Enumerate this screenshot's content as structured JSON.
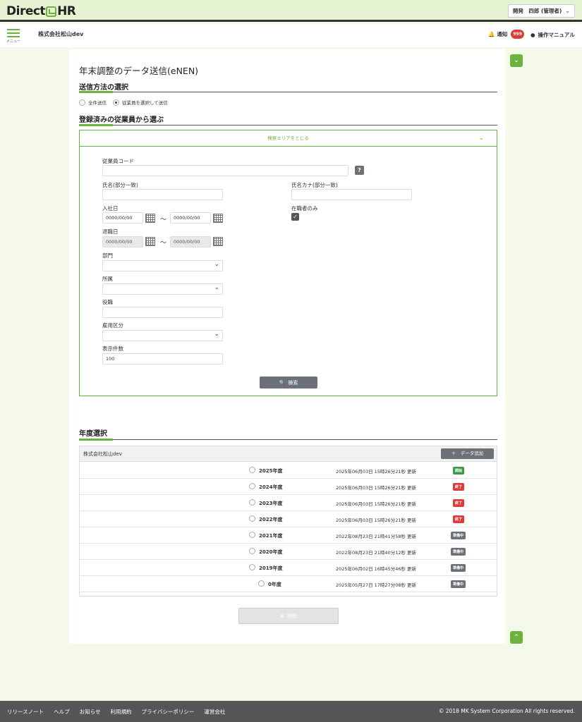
{
  "header": {
    "logo_left": "Direct",
    "logo_right": "HR",
    "user_label": "開発　四郎 (管理者)"
  },
  "subheader": {
    "menu_label": "メニュー",
    "company": "株式会社松山dev",
    "notification_label": "通知",
    "notification_count": "999",
    "manual_label": "操作マニュアル"
  },
  "page": {
    "title": "年末調整のデータ送信(eNEN)",
    "send_method_heading": "送信方法の選択",
    "send_options": [
      "全件送信",
      "従業員を選択して送信"
    ],
    "selected_option": "従業員を選択して送信",
    "registered_heading": "登録済みの従業員から選ぶ"
  },
  "search": {
    "toggle_label": "検索エリアをとじる",
    "employee_code_label": "従業員コード",
    "name_label": "氏名(部分一致)",
    "kana_label": "氏名カナ(部分一致)",
    "hire_date_label": "入社日",
    "retire_date_label": "退職日",
    "date_placeholder": "0000/00/00",
    "range_sep": "～",
    "active_only_label": "在職者のみ",
    "active_only_checked": true,
    "department_label": "部門",
    "affiliation_label": "所属",
    "position_label": "役職",
    "employment_type_label": "雇用区分",
    "display_count_label": "表示件数",
    "display_count_value": "100",
    "help_label": "?",
    "search_button": "検索"
  },
  "year_section": {
    "heading": "年度選択",
    "company": "株式会社松山dev",
    "add_button": "＋　データ追加",
    "rows": [
      {
        "year": "2025年度",
        "updated": "2025年06月03日 15時26分21秒 更新",
        "status": "開始",
        "kind": "start"
      },
      {
        "year": "2024年度",
        "updated": "2025年06月03日 15時26分21秒 更新",
        "status": "終了",
        "kind": "end"
      },
      {
        "year": "2023年度",
        "updated": "2025年06月03日 15時26分21秒 更新",
        "status": "終了",
        "kind": "end"
      },
      {
        "year": "2022年度",
        "updated": "2025年06月03日 15時26分21秒 更新",
        "status": "終了",
        "kind": "end"
      },
      {
        "year": "2021年度",
        "updated": "2022年08月23日 21時41分58秒 更新",
        "status": "準備中",
        "kind": "prep"
      },
      {
        "year": "2020年度",
        "updated": "2022年08月23日 21時40分12秒 更新",
        "status": "準備中",
        "kind": "prep"
      },
      {
        "year": "2019年度",
        "updated": "2025年06月02日 16時45分46秒 更新",
        "status": "準備中",
        "kind": "prep"
      },
      {
        "year": "0年度",
        "updated": "2025年05月27日 17時27分08秒 更新",
        "status": "準備中",
        "kind": "prep"
      }
    ],
    "start_button": "開始"
  },
  "footer": {
    "links": [
      "リリースノート",
      "ヘルプ",
      "お知らせ",
      "利用規約",
      "プライバシーポリシー",
      "運営会社"
    ],
    "copyright": "© 2018 MK System Corporation All rights reserved."
  },
  "colors": {
    "accent": "#6cb33e",
    "header_bg": "#e6f3d2",
    "status_start": "#3a9a4a",
    "status_end": "#e03a3a",
    "status_prep": "#6b7177"
  }
}
